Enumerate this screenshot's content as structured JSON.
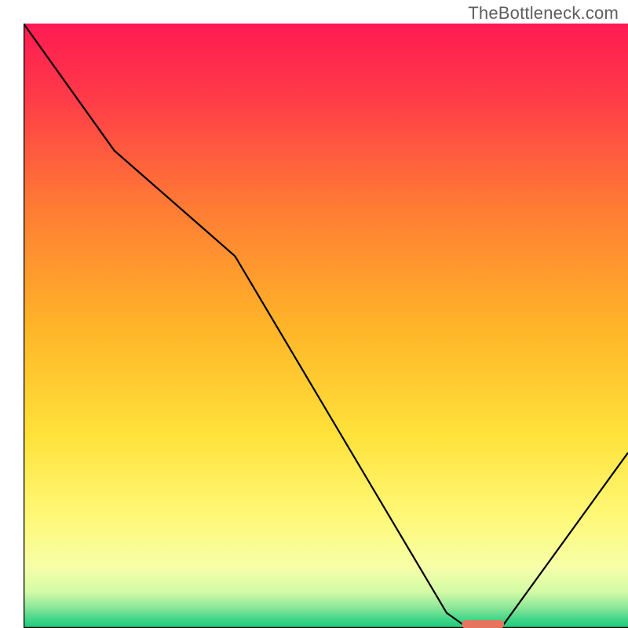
{
  "watermark": "TheBottleneck.com",
  "chart_data": {
    "type": "line",
    "title": "",
    "xlabel": "",
    "ylabel": "",
    "xlim": [
      0,
      100
    ],
    "ylim": [
      0,
      100
    ],
    "grid": false,
    "legend": false,
    "series": [
      {
        "name": "curve",
        "x": [
          0,
          15,
          35,
          70,
          73.5,
          79,
          100
        ],
        "values": [
          100,
          79,
          61.5,
          2.5,
          0,
          0,
          29
        ],
        "color": "#000000"
      }
    ],
    "marker": {
      "name": "highlight-pill",
      "x_center": 76,
      "y_center": 0.6,
      "width": 7,
      "height": 1.4,
      "color": "#e6745f"
    },
    "background": {
      "type": "vertical-gradient",
      "stops": [
        {
          "pos": 0.0,
          "color": "#ff1a52"
        },
        {
          "pos": 0.12,
          "color": "#ff3a49"
        },
        {
          "pos": 0.3,
          "color": "#ff7a35"
        },
        {
          "pos": 0.5,
          "color": "#ffb428"
        },
        {
          "pos": 0.68,
          "color": "#ffe23a"
        },
        {
          "pos": 0.82,
          "color": "#fff97a"
        },
        {
          "pos": 0.9,
          "color": "#f6ffa8"
        },
        {
          "pos": 0.94,
          "color": "#d4fba6"
        },
        {
          "pos": 0.965,
          "color": "#8fe79a"
        },
        {
          "pos": 0.985,
          "color": "#45d68a"
        },
        {
          "pos": 1.0,
          "color": "#1acb7a"
        }
      ]
    },
    "axes": {
      "left": {
        "x": 0,
        "y0": 0,
        "y1": 100
      },
      "bottom": {
        "y": 0,
        "x0": 0,
        "x1": 100
      }
    }
  }
}
